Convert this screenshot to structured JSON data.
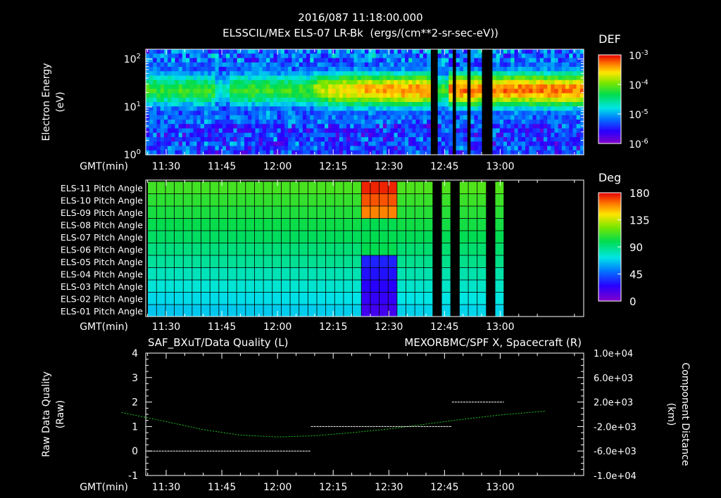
{
  "header": {
    "timestamp": "2016/087 11:18:00.000",
    "subtitle": "ELSSCIL/MEx ELS-07 LR-Bk  (ergs/(cm**2-sr-sec-eV))"
  },
  "time_axis": {
    "label": "GMT(min)",
    "ticks": [
      "11:30",
      "11:45",
      "12:00",
      "12:15",
      "12:30",
      "12:45",
      "13:00"
    ],
    "start_min": 684.5,
    "end_min": 802.5
  },
  "colors": {
    "background": "#000000",
    "axis": "#ffffff",
    "right_trace": "#1ec81e",
    "left_trace": "#ffffff"
  },
  "chart_data": [
    {
      "type": "heatmap",
      "ylabel": "Electron Energy",
      "yunit": "(eV)",
      "yscale": "log",
      "ylim": [
        1,
        160
      ],
      "yticks": [
        {
          "value": 1,
          "base": "10",
          "exp": "0"
        },
        {
          "value": 10,
          "base": "10",
          "exp": "1"
        },
        {
          "value": 100,
          "base": "10",
          "exp": "2"
        }
      ],
      "colorbar": {
        "title": "DEF",
        "scale": "log",
        "ticks": [
          {
            "value": 0.001,
            "base": "10",
            "exp": "-3"
          },
          {
            "value": 0.0001,
            "base": "10",
            "exp": "-4"
          },
          {
            "value": 1e-05,
            "base": "10",
            "exp": "-5"
          },
          {
            "value": 1e-06,
            "base": "10",
            "exp": "-6"
          }
        ]
      },
      "data_gaps_gmt": [
        [
          "12:41",
          "12:43"
        ],
        [
          "12:47",
          "12:48"
        ],
        [
          "12:51",
          "12:52"
        ],
        [
          "12:55",
          "12:58"
        ]
      ]
    },
    {
      "type": "heatmap",
      "rows": [
        "ELS-11 Pitch Angle",
        "ELS-10 Pitch Angle",
        "ELS-09 Pitch Angle",
        "ELS-08 Pitch Angle",
        "ELS-07 Pitch Angle",
        "ELS-06 Pitch Angle",
        "ELS-05 Pitch Angle",
        "ELS-04 Pitch Angle",
        "ELS-03 Pitch Angle",
        "ELS-02 Pitch Angle",
        "ELS-01 Pitch Angle"
      ],
      "colorbar": {
        "title": "Deg",
        "range": [
          0,
          180
        ],
        "ticks": [
          "180",
          "135",
          "90",
          "45",
          "0"
        ]
      },
      "data_start": "11:25",
      "data_end": "13:01",
      "approx_pitch_angles_deg": [
        112,
        108,
        104,
        100,
        96,
        91,
        86,
        80,
        75,
        70,
        66
      ],
      "data_gaps_gmt": [
        [
          "12:41",
          "12:43"
        ],
        [
          "12:47",
          "12:48"
        ],
        [
          "12:51",
          "12:52"
        ],
        [
          "12:55",
          "12:58"
        ]
      ]
    },
    {
      "type": "line",
      "title_left": "SAF_BXuT/Data Quality (L)",
      "title_right": "MEXORBMC/SPF X, Spacecraft (R)",
      "ylabel_left": "Raw Data Quality",
      "yunit_left": "(Raw)",
      "ylim_left": [
        -1,
        4
      ],
      "yticks_left": [
        "4",
        "3",
        "2",
        "1",
        "0",
        "-1"
      ],
      "ylabel_right": "Component Distance",
      "yunit_right": "(km)",
      "ylim_right": [
        -10000,
        10000
      ],
      "yticks_right": [
        "1.0e+04",
        "6.0e+03",
        "2.0e+03",
        "-2.0e+03",
        "-6.0e+03",
        "-1.0e+04"
      ],
      "series": [
        {
          "name": "SAF_BXuT/Data Quality",
          "axis": "left",
          "segments": [
            {
              "x": [
                "11:25",
                "12:09"
              ],
              "y": 0
            },
            {
              "x": [
                "12:09",
                "12:47"
              ],
              "y": 1
            },
            {
              "x": [
                "12:47",
                "13:01"
              ],
              "y": 2
            }
          ]
        },
        {
          "name": "MEXORBMC/SPF X, Spacecraft",
          "axis": "right",
          "x": [
            "11:18",
            "11:30",
            "11:40",
            "11:50",
            "12:00",
            "12:10",
            "12:20",
            "12:30",
            "12:40",
            "12:50",
            "13:00",
            "13:12"
          ],
          "y": [
            300,
            -1200,
            -2500,
            -3400,
            -3700,
            -3500,
            -3000,
            -2400,
            -1600,
            -800,
            -100,
            500
          ]
        }
      ]
    }
  ]
}
